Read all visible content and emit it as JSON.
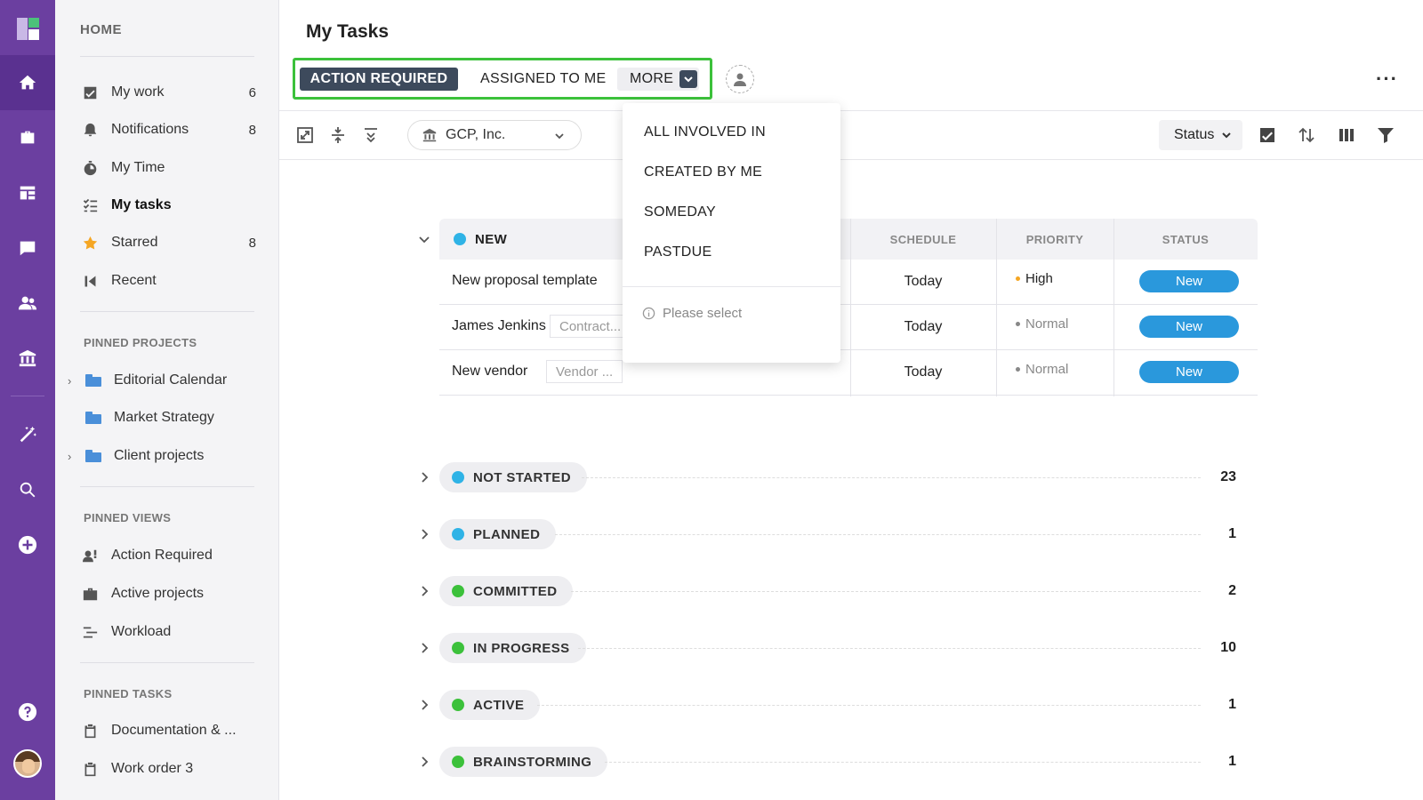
{
  "sidebar": {
    "home_label": "HOME",
    "items": [
      {
        "label": "My work",
        "count": "6",
        "icon": "checkbox-icon"
      },
      {
        "label": "Notifications",
        "count": "8",
        "icon": "bell-icon"
      },
      {
        "label": "My Time",
        "count": "",
        "icon": "stopwatch-icon"
      },
      {
        "label": "My tasks",
        "count": "",
        "icon": "task-list-icon"
      },
      {
        "label": "Starred",
        "count": "8",
        "icon": "star-icon"
      },
      {
        "label": "Recent",
        "count": "",
        "icon": "recent-icon"
      }
    ],
    "pinned_projects_label": "PINNED PROJECTS",
    "pinned_projects": [
      "Editorial Calendar",
      "Market Strategy",
      "Client projects"
    ],
    "pinned_views_label": "PINNED VIEWS",
    "pinned_views": [
      "Action Required",
      "Active projects",
      "Workload"
    ],
    "pinned_tasks_label": "PINNED TASKS",
    "pinned_tasks": [
      "Documentation & ...",
      "Work order 3"
    ]
  },
  "header": {
    "title": "My Tasks",
    "tabs": [
      "ACTION REQUIRED",
      "ASSIGNED TO ME",
      "MORE"
    ]
  },
  "toolbar": {
    "company": "GCP, Inc.",
    "group_by": "Status"
  },
  "dropdown": {
    "items": [
      "ALL INVOLVED IN",
      "CREATED BY ME",
      "SOMEDAY",
      "PASTDUE"
    ],
    "hint": "Please select"
  },
  "table": {
    "group_label": "NEW",
    "columns": [
      "SCHEDULE",
      "PRIORITY",
      "STATUS"
    ],
    "rows": [
      {
        "name": "New proposal template",
        "tag": "",
        "schedule": "Today",
        "priority": "High",
        "status": "New"
      },
      {
        "name": "James Jenkins",
        "tag": "Contract...",
        "schedule": "Today",
        "priority": "Normal",
        "status": "New"
      },
      {
        "name": "New vendor",
        "tag": "Vendor ...",
        "schedule": "Today",
        "priority": "Normal",
        "status": "New"
      }
    ]
  },
  "groups": [
    {
      "label": "NOT STARTED",
      "count": "23",
      "color": "#2fb3e6"
    },
    {
      "label": "PLANNED",
      "count": "1",
      "color": "#2fb3e6"
    },
    {
      "label": "COMMITTED",
      "count": "2",
      "color": "#3cc13b"
    },
    {
      "label": "IN PROGRESS",
      "count": "10",
      "color": "#3cc13b"
    },
    {
      "label": "ACTIVE",
      "count": "1",
      "color": "#3cc13b"
    },
    {
      "label": "BRAINSTORMING",
      "count": "1",
      "color": "#3cc13b"
    }
  ],
  "colors": {
    "rail": "#6b3fa0",
    "accent_green": "#3cc13b",
    "status_badge": "#2a98dc",
    "tab_active": "#3d4a5c"
  }
}
